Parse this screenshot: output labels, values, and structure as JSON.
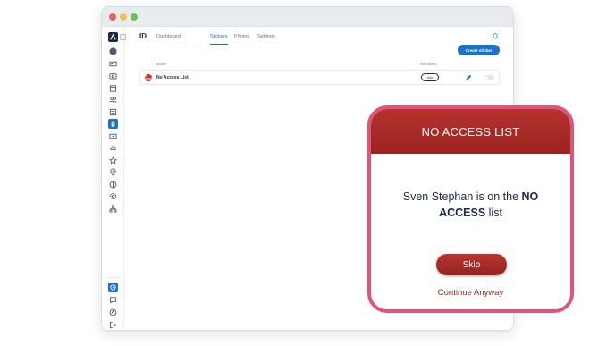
{
  "header": {
    "logo": "ID",
    "nav": [
      "Dashboard",
      "Stickers",
      "Photos",
      "Settings"
    ],
    "active_tab": "Stickers"
  },
  "main": {
    "create_button": "Create sticker",
    "columns": {
      "name": "Name",
      "members": "Members"
    },
    "rows": [
      {
        "badge": "NO ACCESS",
        "name": "No Access List",
        "add_label": "Add",
        "badge_color": "#c0392b"
      }
    ]
  },
  "modal": {
    "title": "NO ACCESS LIST",
    "message_person": "Sven Stephan",
    "message_mid": " is on the ",
    "message_bold": "NO ACCESS",
    "message_end": " list",
    "skip_label": "Skip",
    "continue_label": "Continue Anyway"
  },
  "colors": {
    "accent": "#1a73c8",
    "modal_header": "#a8292a",
    "modal_border": "#e05577",
    "text_dark": "#1b2a4a"
  },
  "icons": {
    "sidebar": [
      "expand-icon",
      "user-avatar-icon",
      "id-card-icon",
      "camera-icon",
      "calendar-icon",
      "users-icon",
      "list-icon",
      "badge-icon",
      "ticket-icon",
      "paint-icon",
      "star-icon",
      "location-icon",
      "globe-icon",
      "settings-icon",
      "network-icon"
    ],
    "sidebar_bottom": [
      "help-icon",
      "chat-icon",
      "account-icon",
      "logout-icon"
    ]
  }
}
